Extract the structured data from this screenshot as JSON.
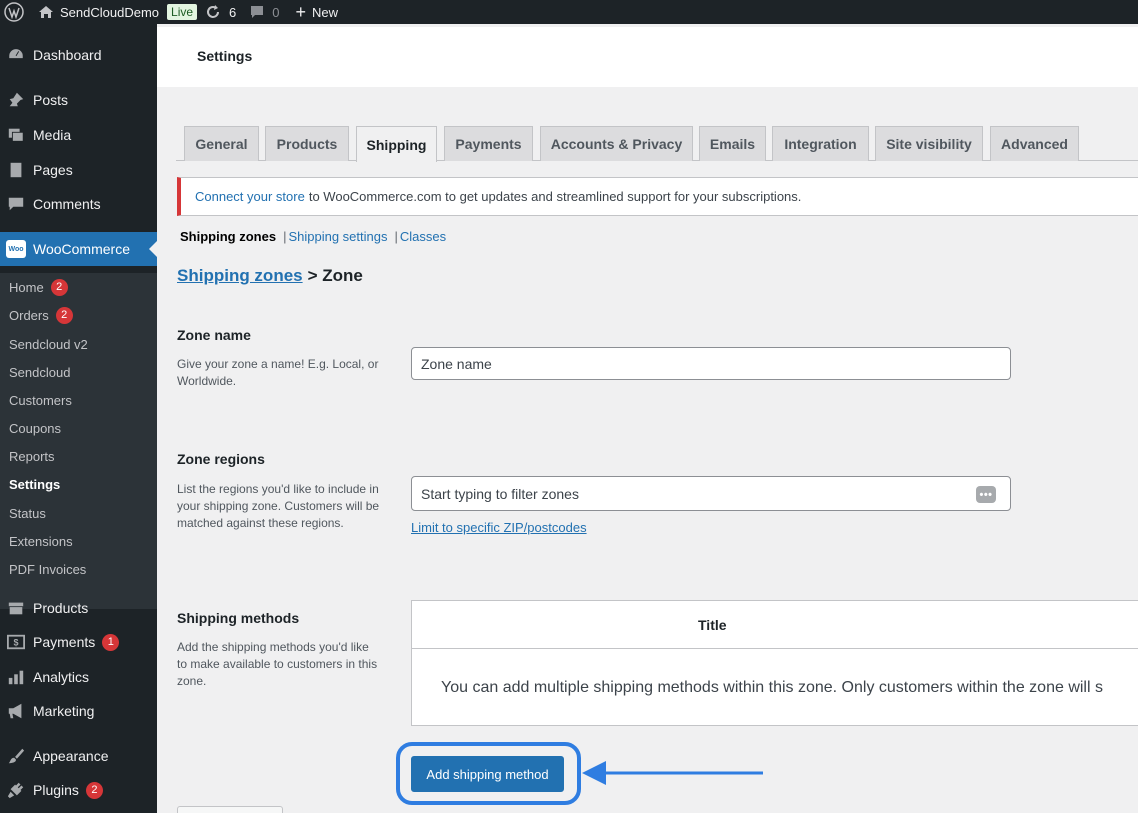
{
  "adminbar": {
    "site_name": "SendCloudDemo",
    "live_badge": "Live",
    "updates_count": "6",
    "comments_count": "0",
    "new_label": "New"
  },
  "sidebar": {
    "top_items": [
      {
        "label": "Dashboard",
        "icon": "dashboard-icon"
      },
      {
        "label": "Posts",
        "icon": "pin-icon"
      },
      {
        "label": "Media",
        "icon": "media-icon"
      },
      {
        "label": "Pages",
        "icon": "pages-icon"
      },
      {
        "label": "Comments",
        "icon": "comment-icon"
      },
      {
        "label": "WooCommerce",
        "icon": "woo-icon"
      }
    ],
    "woo_submenu": [
      {
        "label": "Home",
        "count": "2"
      },
      {
        "label": "Orders",
        "count": "2"
      },
      {
        "label": "Sendcloud v2"
      },
      {
        "label": "Sendcloud"
      },
      {
        "label": "Customers"
      },
      {
        "label": "Coupons"
      },
      {
        "label": "Reports"
      },
      {
        "label": "Settings"
      },
      {
        "label": "Status"
      },
      {
        "label": "Extensions"
      },
      {
        "label": "PDF Invoices"
      }
    ],
    "bottom_items": [
      {
        "label": "Products",
        "icon": "products-icon"
      },
      {
        "label": "Payments",
        "icon": "payments-icon",
        "count": "1"
      },
      {
        "label": "Analytics",
        "icon": "analytics-icon"
      },
      {
        "label": "Marketing",
        "icon": "megaphone-icon"
      },
      {
        "label": "Appearance",
        "icon": "brush-icon"
      },
      {
        "label": "Plugins",
        "icon": "plug-icon",
        "count": "2"
      }
    ]
  },
  "header": {
    "title": "Settings"
  },
  "tabs": [
    {
      "label": "General"
    },
    {
      "label": "Products"
    },
    {
      "label": "Shipping"
    },
    {
      "label": "Payments"
    },
    {
      "label": "Accounts & Privacy"
    },
    {
      "label": "Emails"
    },
    {
      "label": "Integration"
    },
    {
      "label": "Site visibility"
    },
    {
      "label": "Advanced"
    }
  ],
  "active_tab": "Shipping",
  "notice": {
    "link_text": "Connect your store",
    "rest_text": "to WooCommerce.com to get updates and streamlined support for your subscriptions."
  },
  "subnav": {
    "current": "Shipping zones",
    "links": [
      "Shipping settings",
      "Classes"
    ]
  },
  "breadcrumb": {
    "link": "Shipping zones",
    "current": "> Zone"
  },
  "zone_name": {
    "label": "Zone name",
    "description": "Give your zone a name! E.g. Local, or Worldwide.",
    "placeholder": "Zone name"
  },
  "zone_regions": {
    "label": "Zone regions",
    "description": "List the regions you'd like to include in your shipping zone. Customers will be matched against these regions.",
    "placeholder": "Start typing to filter zones",
    "limit_link": "Limit to specific ZIP/postcodes"
  },
  "shipping_methods": {
    "label": "Shipping methods",
    "description": "Add the shipping methods you'd like to make available to customers in this zone.",
    "table_header": "Title",
    "empty_message": "You can add multiple shipping methods within this zone. Only customers within the zone will s",
    "add_button": "Add shipping method"
  },
  "colors": {
    "admin_dark": "#1d2327",
    "accent_blue": "#2271b1",
    "highlight_blue": "#2f7de1",
    "badge_red": "#d63638"
  }
}
